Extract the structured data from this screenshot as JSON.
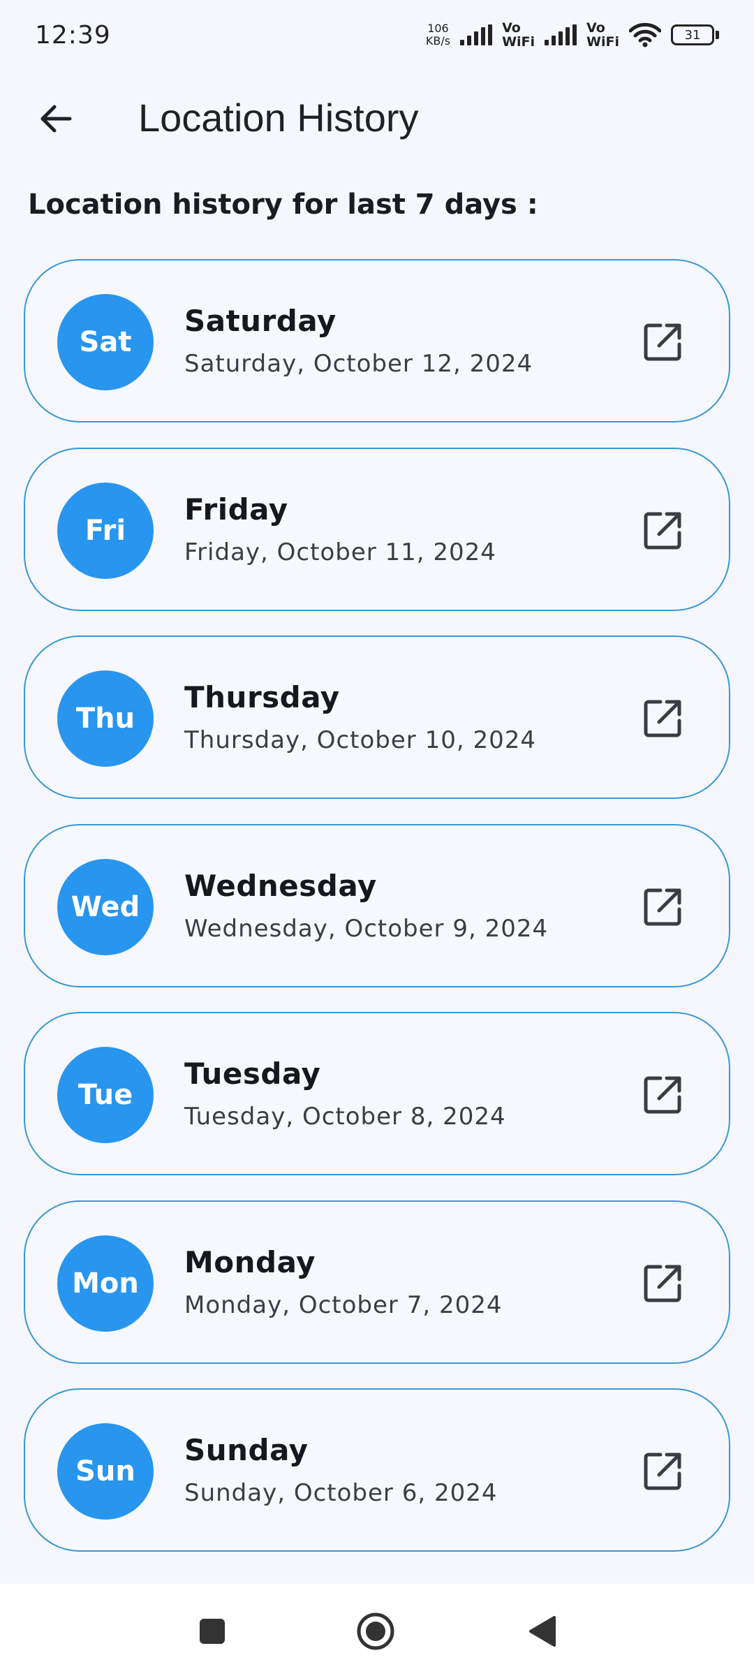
{
  "status_bar": {
    "time": "12:39",
    "net_speed_value": "106",
    "net_speed_unit": "KB/s",
    "vo_label_1": "Vo",
    "wifi_label_1": "WiFi",
    "vo_label_2": "Vo",
    "wifi_label_2": "WiFi",
    "battery": "31"
  },
  "app_bar": {
    "title": "Location History",
    "back_icon": "arrow-left-icon"
  },
  "section": {
    "heading": "Location history for last 7 days :"
  },
  "days": [
    {
      "abbr": "Sat",
      "name": "Saturday",
      "date": "Saturday, October 12, 2024"
    },
    {
      "abbr": "Fri",
      "name": "Friday",
      "date": "Friday, October 11, 2024"
    },
    {
      "abbr": "Thu",
      "name": "Thursday",
      "date": "Thursday, October 10, 2024"
    },
    {
      "abbr": "Wed",
      "name": "Wednesday",
      "date": "Wednesday, October 9, 2024"
    },
    {
      "abbr": "Tue",
      "name": "Tuesday",
      "date": "Tuesday, October 8, 2024"
    },
    {
      "abbr": "Mon",
      "name": "Monday",
      "date": "Monday, October 7, 2024"
    },
    {
      "abbr": "Sun",
      "name": "Sunday",
      "date": "Sunday, October 6, 2024"
    }
  ],
  "colors": {
    "accent": "#2895ef",
    "card_border": "#3a97d2",
    "background": "#f5f7fc"
  },
  "nav_bar": {
    "recent_icon": "square-icon",
    "home_icon": "circle-home-icon",
    "back_icon": "triangle-back-icon"
  }
}
